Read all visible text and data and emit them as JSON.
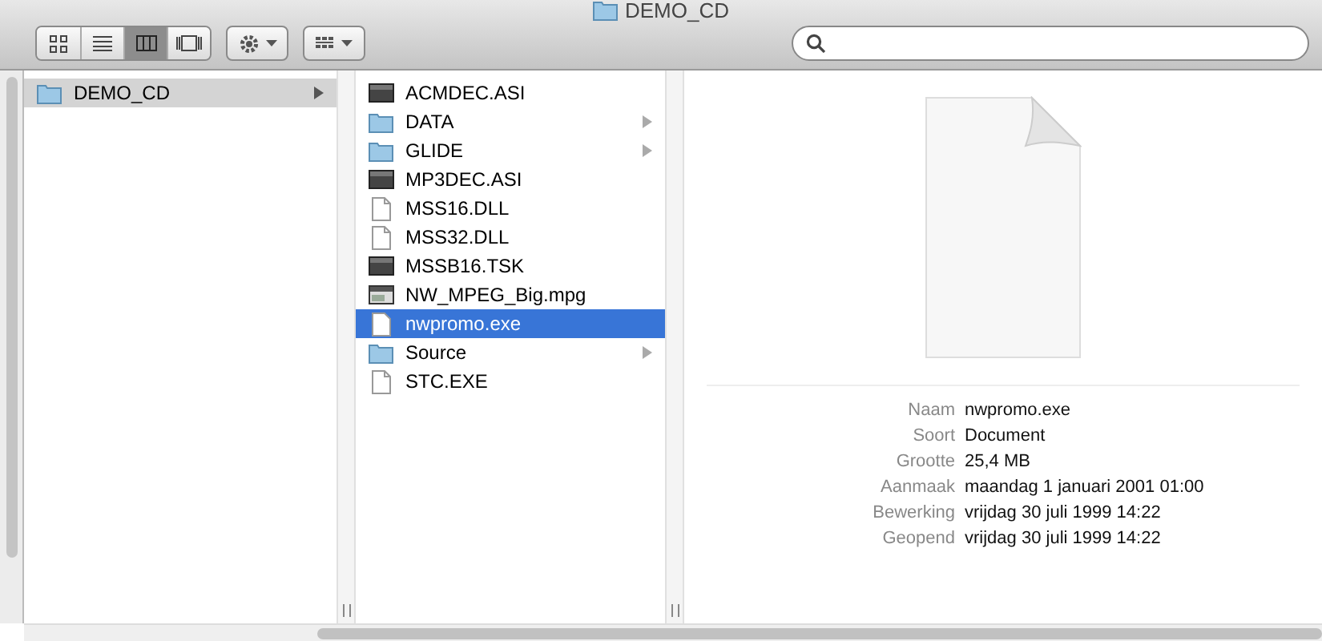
{
  "window": {
    "title": "DEMO_CD"
  },
  "toolbar": {
    "view_buttons": [
      {
        "kind": "icons",
        "selected": false
      },
      {
        "kind": "list",
        "selected": false
      },
      {
        "kind": "columns",
        "selected": true
      },
      {
        "kind": "coverflow",
        "selected": false
      }
    ]
  },
  "columns": [
    {
      "items": [
        {
          "name": "DEMO_CD",
          "kind": "folder",
          "selected": true,
          "has_children": true
        }
      ]
    },
    {
      "items": [
        {
          "name": "ACMDEC.ASI",
          "kind": "app",
          "selected": false,
          "has_children": false
        },
        {
          "name": "DATA",
          "kind": "folder",
          "selected": false,
          "has_children": true
        },
        {
          "name": "GLIDE",
          "kind": "folder",
          "selected": false,
          "has_children": true
        },
        {
          "name": "MP3DEC.ASI",
          "kind": "app",
          "selected": false,
          "has_children": false
        },
        {
          "name": "MSS16.DLL",
          "kind": "document",
          "selected": false,
          "has_children": false
        },
        {
          "name": "MSS32.DLL",
          "kind": "document",
          "selected": false,
          "has_children": false
        },
        {
          "name": "MSSB16.TSK",
          "kind": "app",
          "selected": false,
          "has_children": false
        },
        {
          "name": "NW_MPEG_Big.mpg",
          "kind": "movie",
          "selected": false,
          "has_children": false
        },
        {
          "name": "nwpromo.exe",
          "kind": "document",
          "selected": true,
          "has_children": false
        },
        {
          "name": "Source",
          "kind": "folder",
          "selected": false,
          "has_children": true
        },
        {
          "name": "STC.EXE",
          "kind": "document",
          "selected": false,
          "has_children": false
        }
      ]
    }
  ],
  "preview": {
    "info": [
      {
        "label": "Naam",
        "value": "nwpromo.exe"
      },
      {
        "label": "Soort",
        "value": "Document"
      },
      {
        "label": "Grootte",
        "value": "25,4 MB"
      },
      {
        "label": "Aanmaak",
        "value": "maandag 1 januari 2001 01:00"
      },
      {
        "label": "Bewerking",
        "value": "vrijdag 30 juli 1999 14:22"
      },
      {
        "label": "Geopend",
        "value": "vrijdag 30 juli 1999 14:22"
      }
    ]
  }
}
